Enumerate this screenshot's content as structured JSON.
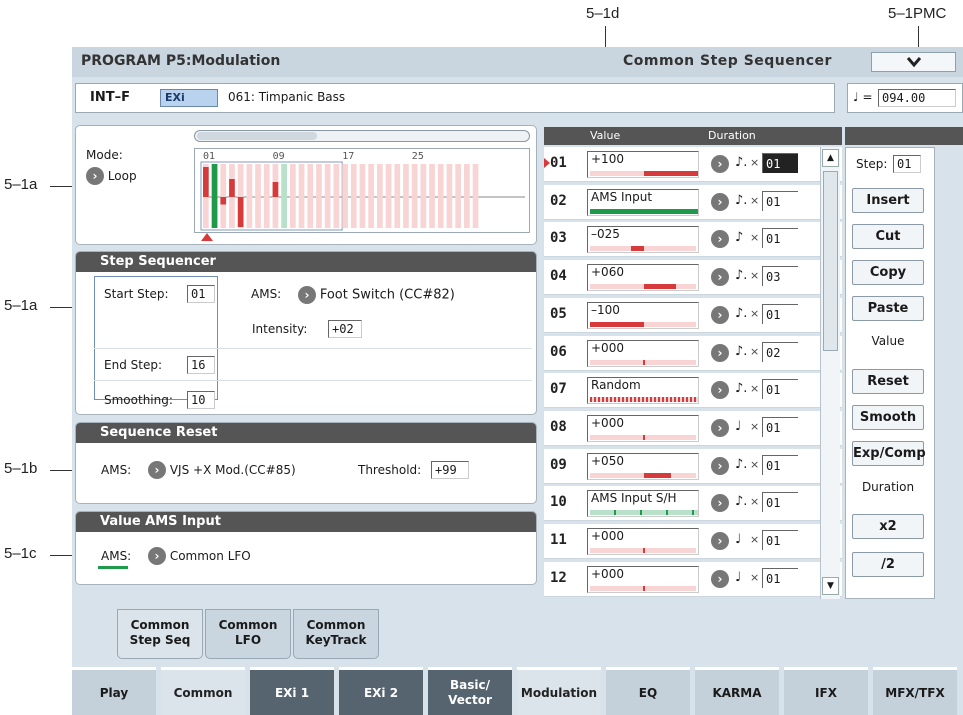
{
  "callouts": {
    "c_1d": "5–1d",
    "c_pmc": "5–1PMC",
    "c_1a_top": "5–1a",
    "c_1a_mid": "5–1a",
    "c_1b": "5–1b",
    "c_1c": "5–1c"
  },
  "header": {
    "title": "PROGRAM P5:Modulation",
    "subtitle": "Common Step Sequencer",
    "menu_icon": "chevron-down-icon"
  },
  "program": {
    "bank": "INT–F",
    "engine": "EXi",
    "name": "061: Timpanic Bass"
  },
  "tempo": {
    "symbol": "♩ =",
    "value": "094.00"
  },
  "mode": {
    "label": "Mode:",
    "value": "Loop",
    "steps_axis": [
      "01",
      "09",
      "17",
      "25"
    ],
    "start_step": 1,
    "end_step": 16
  },
  "step_sequencer": {
    "title": "Step Sequencer",
    "start_label": "Start Step:",
    "start_value": "01",
    "ams_label": "AMS:",
    "ams_value": "Foot Switch (CC#82)",
    "intensity_label": "Intensity:",
    "intensity_value": "+02",
    "end_label": "End Step:",
    "end_value": "16",
    "smoothing_label": "Smoothing:",
    "smoothing_value": "10"
  },
  "sequence_reset": {
    "title": "Sequence Reset",
    "ams_label": "AMS:",
    "ams_value": "VJS +X Mod.(CC#85)",
    "threshold_label": "Threshold:",
    "threshold_value": "+99"
  },
  "value_ams": {
    "title": "Value AMS Input",
    "ams_label": "AMS:",
    "ams_value": "Common LFO"
  },
  "table": {
    "value_header": "Value",
    "duration_header": "Duration",
    "rows": [
      {
        "num": "01",
        "value": "+100",
        "level": 100,
        "note": "♪.",
        "mult": "×",
        "dur": "01"
      },
      {
        "num": "02",
        "value": "AMS Input",
        "level": null,
        "note": "♪.",
        "mult": "×",
        "dur": "01"
      },
      {
        "num": "03",
        "value": "–025",
        "level": -25,
        "note": "♪",
        "mult": "×",
        "dur": "01"
      },
      {
        "num": "04",
        "value": "+060",
        "level": 60,
        "note": "♪.",
        "mult": "×",
        "dur": "03"
      },
      {
        "num": "05",
        "value": "–100",
        "level": -100,
        "note": "♪.",
        "mult": "×",
        "dur": "01"
      },
      {
        "num": "06",
        "value": "+000",
        "level": 0,
        "note": "♪.",
        "mult": "×",
        "dur": "02"
      },
      {
        "num": "07",
        "value": "Random",
        "level": null,
        "note": "♪.",
        "mult": "×",
        "dur": "01"
      },
      {
        "num": "08",
        "value": "+000",
        "level": 0,
        "note": "♩",
        "mult": "×",
        "dur": "01"
      },
      {
        "num": "09",
        "value": "+050",
        "level": 50,
        "note": "♪.",
        "mult": "×",
        "dur": "01"
      },
      {
        "num": "10",
        "value": "AMS Input S/H",
        "level": null,
        "note": "♪.",
        "mult": "×",
        "dur": "01"
      },
      {
        "num": "11",
        "value": "+000",
        "level": 0,
        "note": "♩",
        "mult": "×",
        "dur": "01"
      },
      {
        "num": "12",
        "value": "+000",
        "level": 0,
        "note": "♩",
        "mult": "×",
        "dur": "01"
      }
    ]
  },
  "side": {
    "step_label": "Step:",
    "step_value": "01",
    "insert": "Insert",
    "cut": "Cut",
    "copy": "Copy",
    "paste": "Paste",
    "value_label": "Value",
    "reset": "Reset",
    "smooth": "Smooth",
    "expcomp": "Exp/Comp",
    "duration_label": "Duration",
    "x2": "x2",
    "div2": "/2"
  },
  "subtabs": [
    {
      "l1": "Common",
      "l2": "Step Seq"
    },
    {
      "l1": "Common",
      "l2": "LFO"
    },
    {
      "l1": "Common",
      "l2": "KeyTrack"
    }
  ],
  "tabs": [
    {
      "l1": "Play",
      "l2": ""
    },
    {
      "l1": "Common",
      "l2": ""
    },
    {
      "l1": "EXi 1",
      "l2": ""
    },
    {
      "l1": "EXi 2",
      "l2": ""
    },
    {
      "l1": "Basic/",
      "l2": "Vector"
    },
    {
      "l1": "Modulation",
      "l2": ""
    },
    {
      "l1": "EQ",
      "l2": ""
    },
    {
      "l1": "KARMA",
      "l2": ""
    },
    {
      "l1": "IFX",
      "l2": ""
    },
    {
      "l1": "MFX/TFX",
      "l2": ""
    }
  ],
  "colors": {
    "accent_green": "#1f9a4a",
    "accent_red": "#d63a3a",
    "engine_badge": "#b9d2ee"
  }
}
